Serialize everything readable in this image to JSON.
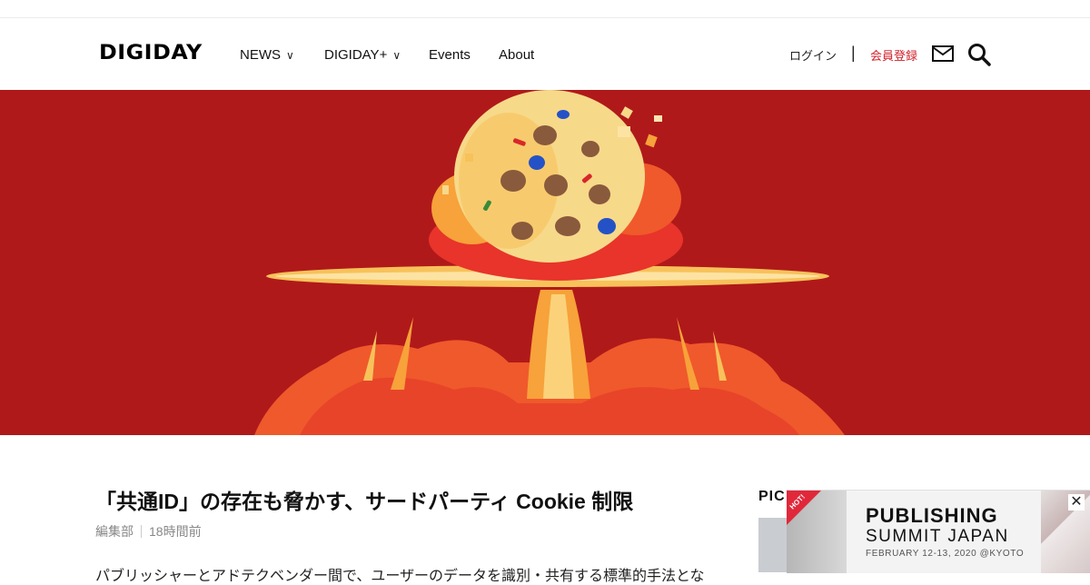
{
  "header": {
    "logo": "DIGIDAY",
    "nav": [
      {
        "label": "NEWS",
        "chevron": "∨"
      },
      {
        "label": "DIGIDAY+",
        "chevron": "∨"
      },
      {
        "label": "Events"
      },
      {
        "label": "About"
      }
    ],
    "login": "ログイン",
    "separator": "|",
    "register": "会員登録",
    "icons": [
      "mail-icon",
      "search-icon"
    ]
  },
  "hero": {
    "image": "cookie-mushroom-cloud-illustration",
    "colors": {
      "background": "#b0191a",
      "flame": "#f0592b",
      "cookie": "#f7d98a"
    }
  },
  "article": {
    "title": "「共通ID」の存在も脅かす、サードパーティ Cookie 制限",
    "author": "編集部",
    "time": "18時間前",
    "excerpt": "パブリッシャーとアドテクベンダー間で、ユーザーのデータを識別・共有する標準的手法とな"
  },
  "sidebar": {
    "heading": "PIC"
  },
  "ad": {
    "badge": "HOT!",
    "title_line1": "PUBLISHING",
    "title_line2": "SUMMIT JAPAN",
    "date": "FEBRUARY 12-13, 2020 @KYOTO",
    "close": "✕"
  },
  "colors": {
    "accent": "#d1202a",
    "text": "#111111",
    "muted": "#888888"
  }
}
